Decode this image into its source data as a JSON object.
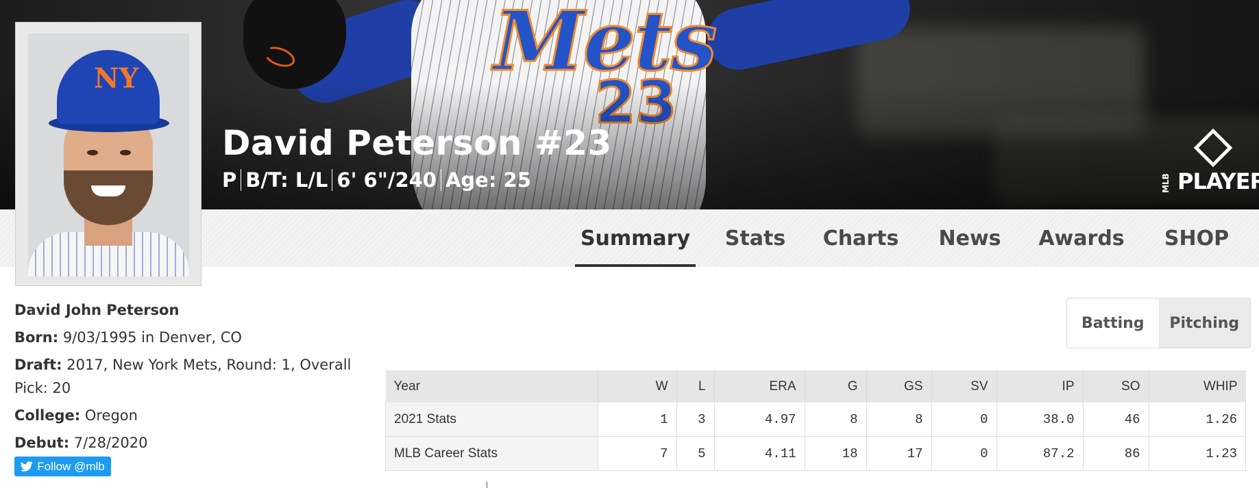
{
  "header": {
    "player_name": "David Peterson #23",
    "meta": [
      "P",
      "B/T: L/L",
      "6' 6\"/240",
      "Age: 25"
    ],
    "logo_text": "PLAYERS",
    "logo_small": "MLB",
    "jersey_script": "Mets",
    "jersey_number": "23",
    "cap_logo": "NY"
  },
  "nav": {
    "tabs": [
      {
        "label": "Summary",
        "active": true
      },
      {
        "label": "Stats",
        "active": false
      },
      {
        "label": "Charts",
        "active": false
      },
      {
        "label": "News",
        "active": false
      },
      {
        "label": "Awards",
        "active": false
      },
      {
        "label": "SHOP",
        "active": false
      }
    ]
  },
  "bio": {
    "full_name": "David John Peterson",
    "born_label": "Born:",
    "born_value": "9/03/1995 in Denver, CO",
    "draft_label": "Draft:",
    "draft_value": "2017, New York Mets, Round: 1, Overall Pick: 20",
    "college_label": "College:",
    "college_value": "Oregon",
    "debut_label": "Debut:",
    "debut_value": "7/28/2020",
    "follow_label": "Follow @mlb"
  },
  "toggle": {
    "options": [
      {
        "label": "Batting",
        "selected": false
      },
      {
        "label": "Pitching",
        "selected": true
      }
    ]
  },
  "stats_table": {
    "headers": [
      "Year",
      "W",
      "L",
      "ERA",
      "G",
      "GS",
      "SV",
      "IP",
      "SO",
      "WHIP"
    ],
    "rows": [
      [
        "2021 Stats",
        "1",
        "3",
        "4.97",
        "8",
        "8",
        "0",
        "38.0",
        "46",
        "1.26"
      ],
      [
        "MLB Career Stats",
        "7",
        "5",
        "4.11",
        "18",
        "17",
        "0",
        "87.2",
        "86",
        "1.23"
      ]
    ]
  },
  "colors": {
    "mets_blue": "#1f45b5",
    "mets_orange": "#f28b2c",
    "twitter_blue": "#1d9bf0"
  }
}
